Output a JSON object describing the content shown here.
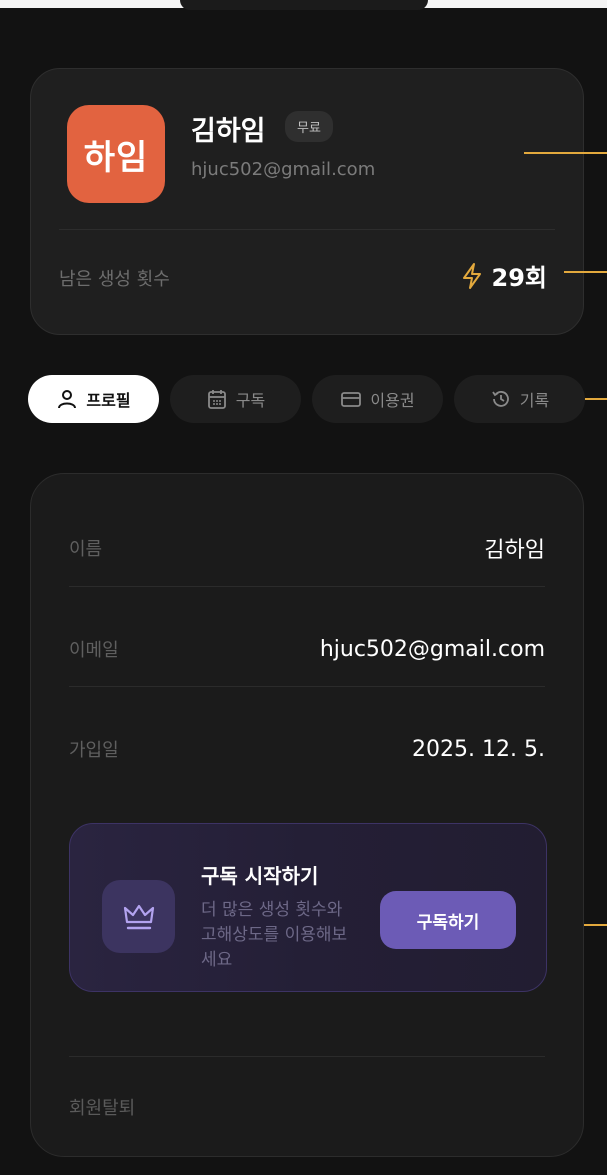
{
  "profile": {
    "avatar_text": "하임",
    "name": "김하임",
    "plan": "무료",
    "email": "hjuc502@gmail.com",
    "remaining_label": "남은 생성 횟수",
    "remaining_value": "29회"
  },
  "tabs": [
    {
      "label": "프로필",
      "icon": "person-icon",
      "active": true
    },
    {
      "label": "구독",
      "icon": "calendar-icon",
      "active": false
    },
    {
      "label": "이용권",
      "icon": "credit-card-icon",
      "active": false
    },
    {
      "label": "기록",
      "icon": "history-icon",
      "active": false
    }
  ],
  "info": {
    "name_label": "이름",
    "name_value": "김하임",
    "email_label": "이메일",
    "email_value": "hjuc502@gmail.com",
    "joined_label": "가입일",
    "joined_value": "2025. 12. 5."
  },
  "promo": {
    "title": "구독 시작하기",
    "description": "더 많은 생성 횟수와 고해상도를 이용해보세요",
    "button": "구독하기"
  },
  "withdraw_label": "회원탈퇴",
  "colors": {
    "background": "#121212",
    "avatar": "#e26340",
    "accent_purple": "#6c5bb6",
    "bolt": "#e3a93d"
  }
}
